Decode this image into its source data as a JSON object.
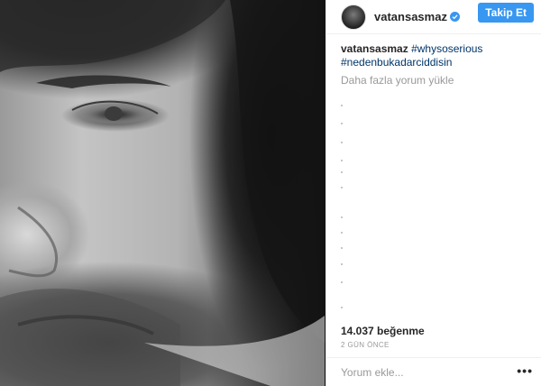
{
  "post": {
    "username": "vatansasmaz",
    "follow_label": "Takip Et",
    "caption_user": "vatansasmaz",
    "caption_tag_1": "#whysoserious",
    "caption_tag_2": "#nedenbukadarciddisin",
    "load_more": "Daha fazla yorum yükle",
    "likes": "14.037 beğenme",
    "timestamp": "2 GÜN ÖNCE",
    "comment_placeholder": "Yorum ekle...",
    "more_glyph": "•••"
  },
  "icons": {
    "verified": "verified-badge-icon",
    "more": "more-options-icon"
  },
  "colors": {
    "accent": "#3897f0",
    "hashtag": "#003569",
    "muted": "#999999"
  }
}
